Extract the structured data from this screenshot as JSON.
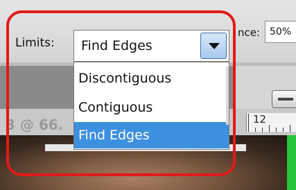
{
  "options_bar": {
    "limits_label": "Limits:",
    "limits_value": "Find Edges",
    "tolerance_label_fragment": "nce:",
    "tolerance_value_fragment": "50%"
  },
  "dropdown": {
    "items": [
      {
        "label": "Discontiguous",
        "selected": false
      },
      {
        "label": "Contiguous",
        "selected": false
      },
      {
        "label": "Find Edges",
        "selected": true
      }
    ]
  },
  "document": {
    "tab_title_fragment": "3 @ 66."
  },
  "ruler": {
    "label": "12"
  },
  "colors": {
    "highlight": "#e11a1a",
    "selected_item": "#3d8fe0"
  }
}
